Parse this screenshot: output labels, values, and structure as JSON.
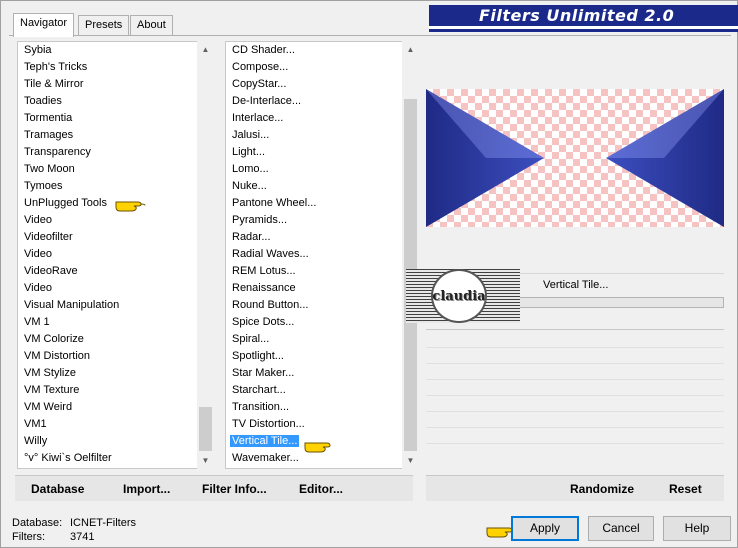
{
  "tabs": [
    {
      "label": "Navigator",
      "active": true
    },
    {
      "label": "Presets",
      "active": false
    },
    {
      "label": "About",
      "active": false
    }
  ],
  "banner": {
    "title": "Filters Unlimited 2.0"
  },
  "category_list": {
    "items": [
      "Sybia",
      "Teph's Tricks",
      "Tile & Mirror",
      "Toadies",
      "Tormentia",
      "Tramages",
      "Transparency",
      "Two Moon",
      "Tymoes",
      "UnPlugged Tools",
      "Video",
      "Videofilter",
      "Video",
      "VideoRave",
      "Video",
      "Visual Manipulation",
      "VM 1",
      "VM Colorize",
      "VM Distortion",
      "VM Stylize",
      "VM Texture",
      "VM Weird",
      "VM1",
      "Willy",
      "°v° Kiwi`s Oelfilter"
    ],
    "pointer_item": "UnPlugged Tools"
  },
  "filter_list": {
    "items": [
      "CD Shader...",
      "Compose...",
      "CopyStar...",
      "De-Interlace...",
      "Interlace...",
      "Jalusi...",
      "Light...",
      "Lomo...",
      "Nuke...",
      "Pantone Wheel...",
      "Pyramids...",
      "Radar...",
      "Radial Waves...",
      "REM Lotus...",
      "Renaissance",
      "Round Button...",
      "Spice Dots...",
      "Spiral...",
      "Spotlight...",
      "Star Maker...",
      "Starchart...",
      "Transition...",
      "TV Distortion...",
      "Vertical Tile...",
      "Wavemaker..."
    ],
    "selected": "Vertical Tile..."
  },
  "preview": {
    "shape_color": "#2a3590",
    "checker_color": "#f6c3c3"
  },
  "parameters": {
    "filter_name": "Vertical Tile..."
  },
  "watermark": {
    "text": "claudia"
  },
  "left_buttons": [
    {
      "label": "Database",
      "accel": "D"
    },
    {
      "label": "Import...",
      "accel": "I"
    },
    {
      "label": "Filter Info...",
      "accel": "I"
    },
    {
      "label": "Editor...",
      "accel": "E"
    }
  ],
  "right_buttons": [
    {
      "label": "Randomize"
    },
    {
      "label": "Reset"
    }
  ],
  "status": {
    "database_label": "Database:",
    "database_value": "ICNET-Filters",
    "filters_label": "Filters:",
    "filters_value": "3741"
  },
  "dialog_buttons": {
    "apply": "Apply",
    "cancel": "Cancel",
    "help": "Help"
  },
  "colors": {
    "selection": "#3399ff",
    "banner": "#1b2a8a"
  },
  "icons": {
    "pointer": "pointing-hand-icon"
  }
}
